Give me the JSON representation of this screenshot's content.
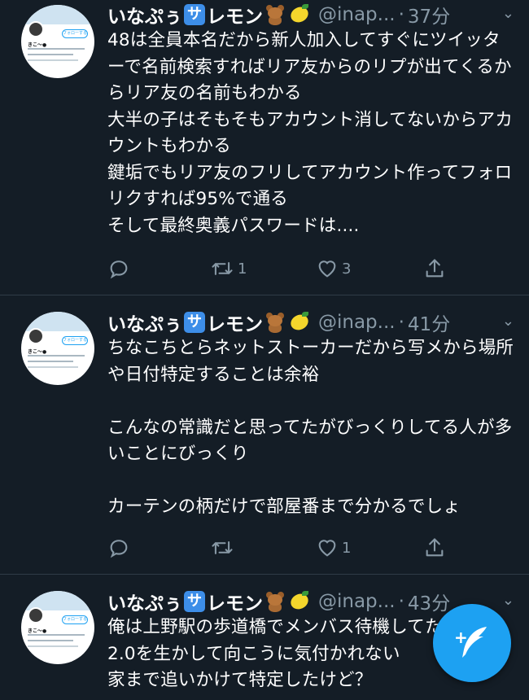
{
  "tweets": [
    {
      "display_name": "いなぷぅ",
      "name_suffix": "レモン",
      "badge_char": "サ",
      "emojis": [
        "teddy-bear-emoji",
        "lemon-emoji"
      ],
      "handle": "@inap...",
      "separator": "·",
      "time": "37分",
      "avatar_text": "きこ～●",
      "avatar_follow": "フォローする",
      "text": "48は全員本名だから新人加入してすぐにツイッターで名前検索すればリア友からのリプが出てくるからリア友の名前もわかる\n大半の子はそもそもアカウント消してないからアカウントもわかる\n鍵垢でもリア友のフリしてアカウント作ってフォロリクすれば95%で通る\nそして最終奥義パスワードは....",
      "replies": "",
      "retweets": "1",
      "likes": "3"
    },
    {
      "display_name": "いなぷぅ",
      "name_suffix": "レモン",
      "badge_char": "サ",
      "emojis": [
        "teddy-bear-emoji",
        "lemon-emoji"
      ],
      "handle": "@inap...",
      "separator": "·",
      "time": "41分",
      "avatar_text": "きこ～●",
      "avatar_follow": "フォローする",
      "text": "ちなこちとらネットストーカーだから写メから場所や日付特定することは余裕\n\nこんなの常識だと思ってたがびっくりしてる人が多いことにびっくり\n\nカーテンの柄だけで部屋番まで分かるでしょ",
      "replies": "",
      "retweets": "",
      "likes": "1"
    },
    {
      "display_name": "いなぷぅ",
      "name_suffix": "レモン",
      "badge_char": "サ",
      "emojis": [
        "teddy-bear-emoji",
        "lemon-emoji"
      ],
      "handle": "@inap...",
      "separator": "·",
      "time": "43分",
      "avatar_text": "きこ～●",
      "avatar_follow": "フォローする",
      "text": "俺は上野駅の歩道橋でメンバス待機してた\n2.0を生かして向こうに気付かれない\n家まで追いかけて特定したけど？",
      "replies": "",
      "retweets": "",
      "likes": ""
    }
  ],
  "compose_button": {
    "label": "+",
    "icon": "feather-compose-icon"
  },
  "colors": {
    "background": "#141d26",
    "text": "#ffffff",
    "secondary": "#8899a6",
    "accent": "#1da1f2",
    "divider": "#2f3b47"
  }
}
